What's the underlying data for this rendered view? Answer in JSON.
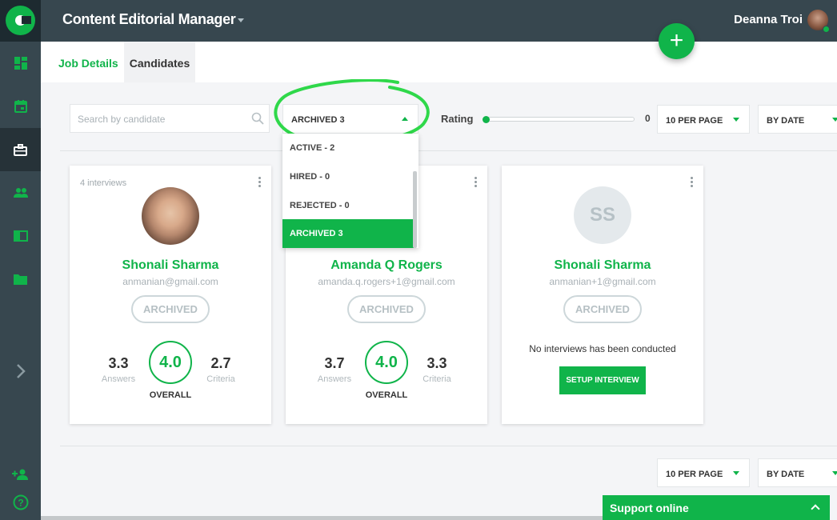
{
  "app": {
    "title": "Content Editorial Manager",
    "user_name": "Deanna Troi"
  },
  "tabs": [
    {
      "label": "Job Details"
    },
    {
      "label": "Candidates"
    }
  ],
  "filters": {
    "search_placeholder": "Search by candidate",
    "status_selected": "ARCHIVED 3",
    "status_options": [
      "ACTIVE - 2",
      "HIRED - 0",
      "REJECTED - 0",
      "ARCHIVED 3"
    ],
    "rating_label": "Rating",
    "rating_value": "0",
    "per_page": "10 PER PAGE",
    "sort": "BY DATE"
  },
  "candidates": [
    {
      "interviews": "4 interviews",
      "name": "Shonali Sharma",
      "email": "anmanian@gmail.com",
      "status": "ARCHIVED",
      "answers": "3.3",
      "answers_label": "Answers",
      "overall": "4.0",
      "overall_label": "OVERALL",
      "criteria": "2.7",
      "criteria_label": "Criteria"
    },
    {
      "name": "Amanda Q Rogers",
      "email": "amanda.q.rogers+1@gmail.com",
      "status": "ARCHIVED",
      "answers": "3.7",
      "answers_label": "Answers",
      "overall": "4.0",
      "overall_label": "OVERALL",
      "criteria": "3.3",
      "criteria_label": "Criteria"
    },
    {
      "initials": "SS",
      "name": "Shonali Sharma",
      "email": "anmanian+1@gmail.com",
      "status": "ARCHIVED",
      "no_interviews": "No interviews has been conducted",
      "setup_label": "SETUP INTERVIEW"
    }
  ],
  "bottom_pager": {
    "per_page": "10 PER PAGE",
    "sort": "BY DATE"
  },
  "support": {
    "label": "Support online"
  },
  "colors": {
    "accent": "#10b44a",
    "sidebar": "#37474f",
    "sidebar_active": "#263238"
  },
  "icons": [
    "dashboard-icon",
    "calendar-icon",
    "briefcase-icon",
    "people-icon",
    "book-icon",
    "folder-icon",
    "chevron-right-icon",
    "add-person-icon",
    "help-icon",
    "search-icon",
    "plus-icon"
  ]
}
